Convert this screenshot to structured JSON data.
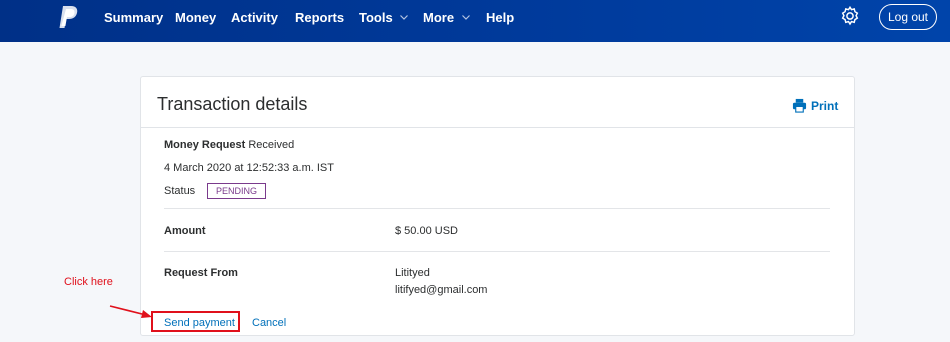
{
  "nav": {
    "logo_icon": "paypal-logo",
    "items": [
      {
        "label": "Summary"
      },
      {
        "label": "Money"
      },
      {
        "label": "Activity"
      },
      {
        "label": "Reports"
      },
      {
        "label": "Tools",
        "dropdown": true
      },
      {
        "label": "More",
        "dropdown": true
      },
      {
        "label": "Help"
      }
    ],
    "settings_icon": "gear-icon",
    "logout_label": "Log out",
    "bar_color": "#003087"
  },
  "transaction": {
    "title": "Transaction details",
    "print_label": "Print",
    "type_label": "Money Request",
    "type_value": "Received",
    "date": "4 March 2020 at 12:52:33 a.m. IST",
    "status_label": "Status",
    "status_value": "PENDING",
    "amount_label": "Amount",
    "amount_value": "$ 50.00 USD",
    "request_from_label": "Request From",
    "request_from_name": "Litityed",
    "request_from_email": "litifyed@gmail.com",
    "actions": {
      "send_payment": "Send payment",
      "cancel": "Cancel"
    }
  },
  "annotation": {
    "text": "Click here",
    "color": "#e0101b"
  },
  "colors": {
    "link": "#0070ba",
    "pending": "#7a3a8c"
  }
}
